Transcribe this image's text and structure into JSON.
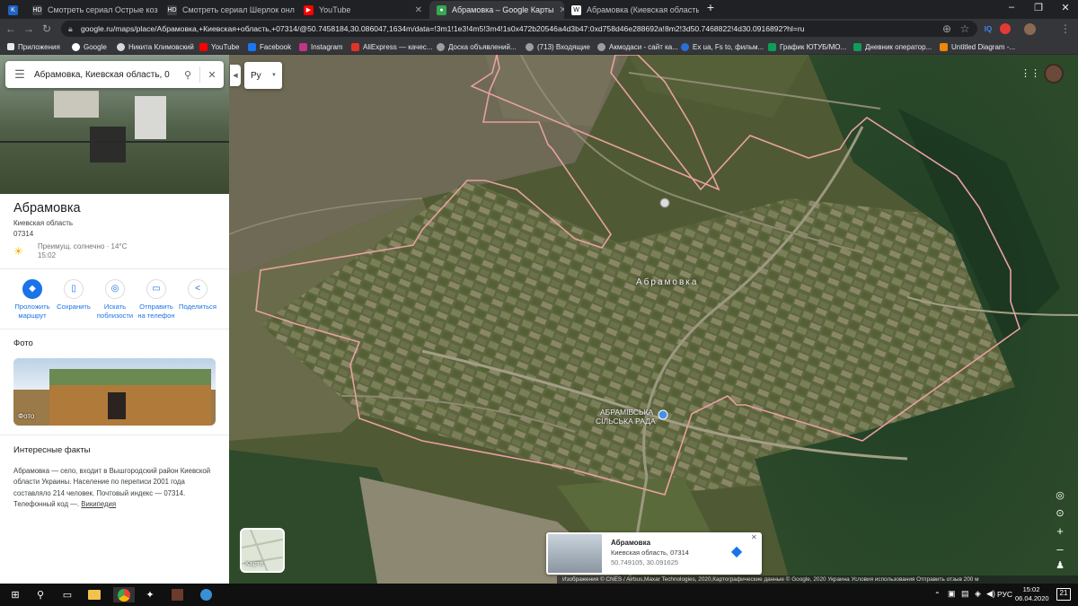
{
  "browser": {
    "tabs": [
      {
        "label": "Смотреть сериал Острые козырьки",
        "color": "#1e63c4",
        "glyph": "K"
      },
      {
        "label": "Смотреть сериал Шерлок онлайн",
        "color": "#3c4043",
        "glyph": "HD"
      },
      {
        "label": "YouTube",
        "color": "#ff0000",
        "glyph": "▶"
      },
      {
        "label": "Абрамовка – Google Карты",
        "color": "#34a853",
        "glyph": "●"
      },
      {
        "label": "Абрамовка (Киевская область)",
        "color": "#ffffff",
        "glyph": "W"
      }
    ],
    "new_tab": "+",
    "window_controls": [
      "–",
      "❐",
      "✕"
    ],
    "url": "google.ru/maps/place/Абрамовка,+Киевская+область,+07314/@50.7458184,30.086047,1634m/data=!3m1!1e3!4m5!3m4!1s0x472b20546a4d3b47:0xd758d46e288692a!8m2!3d50.7468822!4d30.0916892?hl=ru",
    "bookmarks": [
      {
        "label": "Приложения",
        "color": "#e8eaed"
      },
      {
        "label": "Google",
        "color": "#4285f4"
      },
      {
        "label": "Никита Климовский",
        "color": "#c4302b"
      },
      {
        "label": "YouTube",
        "color": "#ff0000"
      },
      {
        "label": "Facebook",
        "color": "#1877f2"
      },
      {
        "label": "Instagram",
        "color": "#c13584"
      },
      {
        "label": "AliExpress — качес...",
        "color": "#e43225"
      },
      {
        "label": "Доска объявлений...",
        "color": "#888888"
      },
      {
        "label": "(713) Входящие",
        "color": "#888888"
      },
      {
        "label": "Акмодаси - сайт ка...",
        "color": "#888888"
      },
      {
        "label": "Ex ua, Fs to, фильм...",
        "color": "#2b6fd6"
      },
      {
        "label": "График ЮТУБ/МО...",
        "color": "#0f9d58"
      },
      {
        "label": "Дневник оператор...",
        "color": "#0f9d58"
      },
      {
        "label": "Untitled Diagram -...",
        "color": "#f08705"
      }
    ]
  },
  "search": {
    "value": "Абрамовка, Киевская область, 0",
    "lang": "Ру"
  },
  "place": {
    "title": "Абрамовка",
    "region": "Киевская область",
    "postcode": "07314",
    "weather": "Преимущ. солнечно · 14°C",
    "weather_time": "15:02",
    "actions": [
      {
        "label": "Проложить маршрут",
        "icon": "◆"
      },
      {
        "label": "Сохранить",
        "icon": "▯"
      },
      {
        "label": "Искать поблизости",
        "icon": "◎"
      },
      {
        "label": "Отправить на телефон",
        "icon": "▭"
      },
      {
        "label": "Поделиться",
        "icon": "<"
      }
    ],
    "photo_section": "Фото",
    "photo_caption": "Фото",
    "facts_title": "Интересные факты",
    "facts_text": "Абрамовка — село, входит в Вышгородский район Киевской области Украины. Население по переписи 2001 года составляло 214 человек. Почтовый индекс — 07314. Телефонный код —.",
    "facts_link": "Википедия"
  },
  "map": {
    "village_label": "Абрамовка",
    "poi_label_line1": "АБРАМІВСЬКА",
    "poi_label_line2": "СІЛЬСЬКА РАДА",
    "layer_button": "Карта",
    "card": {
      "title": "Абрамовка",
      "subtitle": "Киевская область, 07314",
      "coords": "50.749105, 30.091625"
    },
    "attribution": "Изображения © CNES / Airbus,Maxar Technologies, 2020,Картографические данные © Google, 2020    Украина    Условия использования    Отправить отзыв    200 м",
    "boundary_color": "#e8a0a0"
  },
  "taskbar": {
    "time": "15:02",
    "date": "06.04.2020",
    "lang": "РУС",
    "notifications": "21"
  }
}
